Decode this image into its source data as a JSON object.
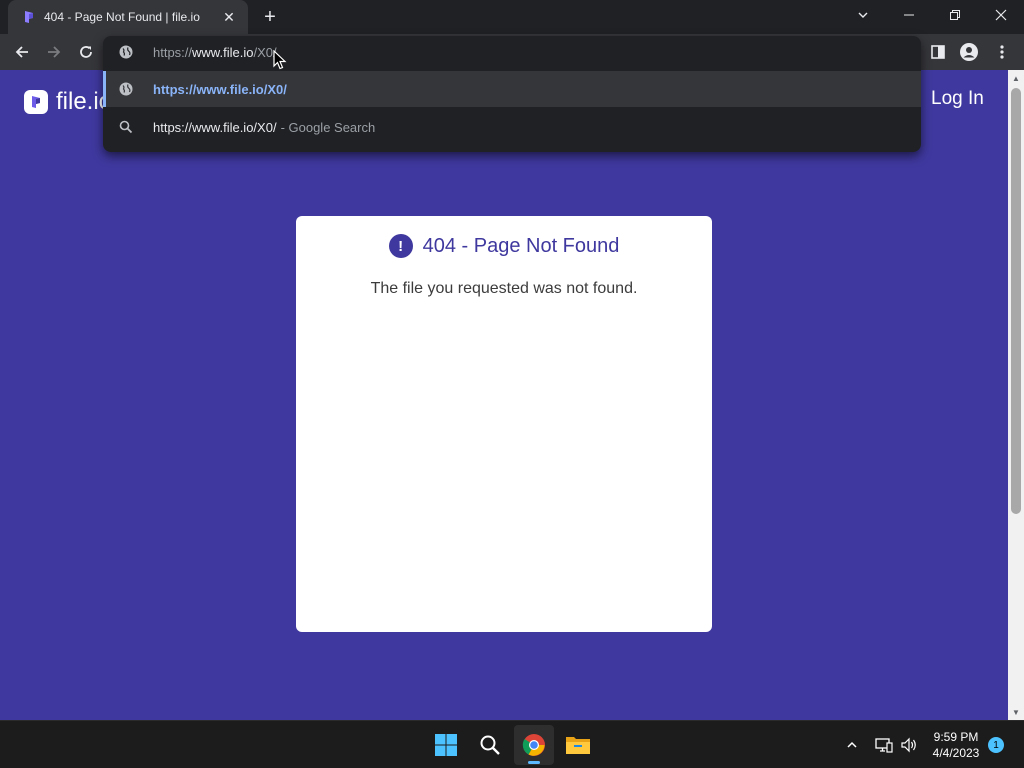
{
  "browser": {
    "tab": {
      "title": "404 - Page Not Found | file.io",
      "close_label": "✕"
    },
    "new_tab_label": "+",
    "omnibox": {
      "url_scheme": "https://",
      "url_host": "www.file.io",
      "url_path": "/X0/",
      "suggestions": [
        {
          "text": "https://www.file.io/X0/",
          "suffix": "",
          "icon": "globe-icon"
        },
        {
          "text": "https://www.file.io/X0/",
          "suffix": "- Google Search",
          "icon": "search-icon"
        }
      ]
    }
  },
  "page": {
    "logo_text": "file.io",
    "login_label": "Log In",
    "error": {
      "icon_text": "!",
      "title": "404 - Page Not Found",
      "message": "The file you requested was not found."
    }
  },
  "taskbar": {
    "time": "9:59 PM",
    "date": "4/4/2023",
    "notification_count": "1",
    "apps": [
      "start-icon",
      "search-icon",
      "chrome-icon",
      "file-explorer-icon"
    ]
  },
  "colors": {
    "page_background": "#3f389e",
    "card_background": "#ffffff",
    "link_highlight": "#8ab4f8",
    "browser_frame": "#202124",
    "toolbar": "#35363a"
  }
}
